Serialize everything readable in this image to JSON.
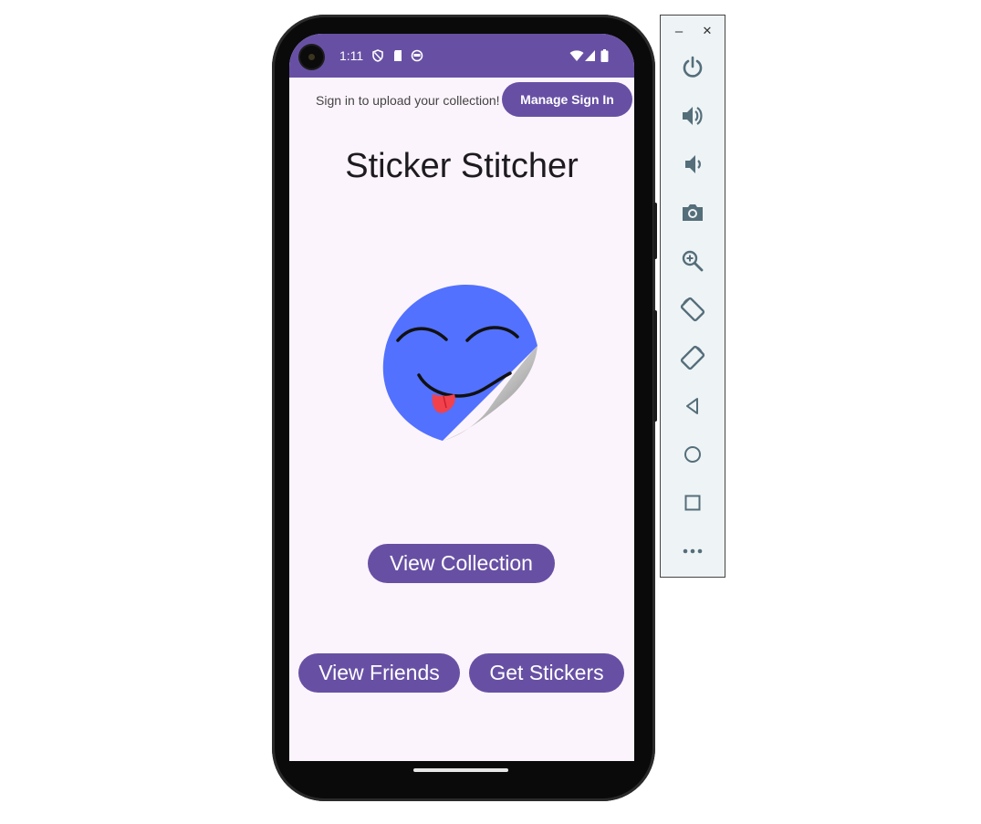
{
  "status_bar": {
    "time": "1:11",
    "icons": [
      "shield-icon",
      "sd-card-icon",
      "face-circle-icon"
    ],
    "right_icons": [
      "wifi-icon",
      "signal-icon",
      "battery-icon"
    ]
  },
  "auth": {
    "prompt": "Sign in to upload your collection!",
    "manage_label": "Manage Sign In"
  },
  "main": {
    "title": "Sticker Stitcher",
    "view_collection_label": "View Collection",
    "view_friends_label": "View Friends",
    "get_stickers_label": "Get Stickers"
  },
  "emulator_panel": {
    "minimize_glyph": "–",
    "close_glyph": "✕",
    "tools": [
      "power",
      "volume-up",
      "volume-down",
      "screenshot",
      "zoom",
      "rotate-left",
      "rotate-right",
      "back",
      "home",
      "overview",
      "more"
    ]
  },
  "colors": {
    "primary": "#6750a4",
    "background": "#fcf4fc",
    "sticker": "#5271ff",
    "tongue": "#f0414d"
  }
}
